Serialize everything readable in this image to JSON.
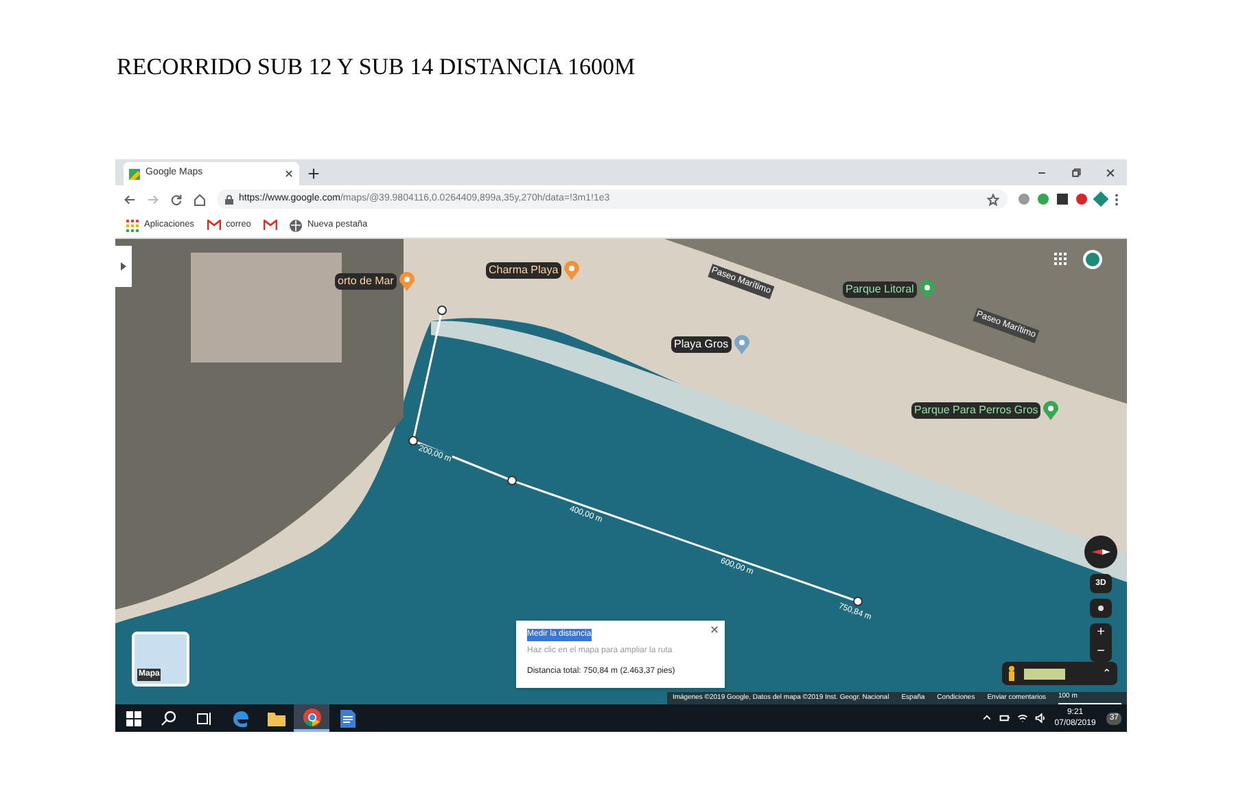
{
  "document": {
    "title": "RECORRIDO SUB 12 Y SUB 14 DISTANCIA 1600M"
  },
  "browser": {
    "tab": {
      "title": "Google Maps"
    },
    "url": {
      "host": "https://www.google.com",
      "path": "/maps/@39.9804116,0.0264409,899a,35y,270h/data=!3m1!1e3"
    },
    "bookmarks": [
      {
        "kind": "apps",
        "label": "Aplicaciones"
      },
      {
        "kind": "mail",
        "label": "correo"
      },
      {
        "kind": "mail"
      },
      {
        "kind": "globe",
        "label": "Nueva pestaña"
      }
    ]
  },
  "map": {
    "places": [
      {
        "kind": "food",
        "label": "orto de Mar"
      },
      {
        "kind": "food",
        "label": "Charma Playa"
      },
      {
        "kind": "park",
        "label": "Parque Litoral"
      },
      {
        "kind": "poi",
        "label": "Playa Gros"
      },
      {
        "kind": "park",
        "label": "Parque Para Perros Gros"
      }
    ],
    "streets": [
      "Paseo Marítimo",
      "Paseo Marítimo"
    ],
    "measure_labels": [
      "200,00 m",
      "400,00 m",
      "600,00 m",
      "750,84 m"
    ],
    "dialog": {
      "title": "Medir la distancia",
      "hint": "Haz clic en el mapa para ampliar la ruta",
      "total": "Distancia total: 750,84 m (2.463,37 pies)"
    },
    "layer_thumbnail": "Mapa",
    "controls": {
      "tilt": "3D",
      "zoom_in": "+",
      "zoom_out": "−",
      "expand": "⌃"
    },
    "attribution": [
      "Imágenes ©2019 Google, Datos del mapa ©2019 Inst. Geogr. Nacional",
      "España",
      "Condiciones",
      "Enviar comentarios"
    ],
    "scale": "100 m"
  },
  "taskbar": {
    "apps": [
      {
        "kind": "windows",
        "selected": false
      },
      {
        "kind": "search",
        "selected": false
      },
      {
        "kind": "taskview",
        "selected": false
      },
      {
        "kind": "edge",
        "selected": false
      },
      {
        "kind": "folder",
        "selected": false
      },
      {
        "kind": "chrome",
        "selected": true
      },
      {
        "kind": "document",
        "selected": false
      }
    ],
    "time": "9:21",
    "date": "07/08/2019",
    "notifications": "37"
  }
}
